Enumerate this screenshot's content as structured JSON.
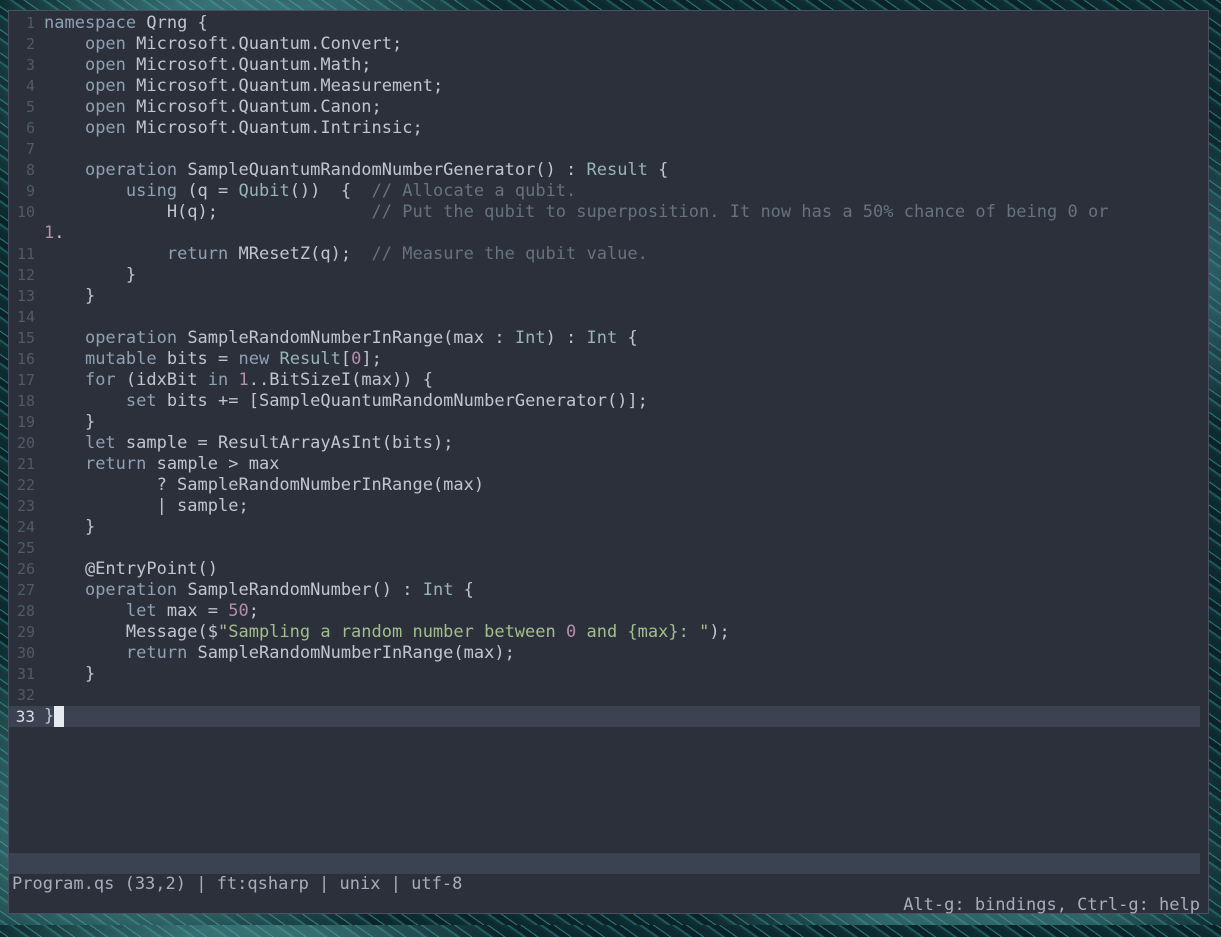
{
  "editor": {
    "lines": [
      {
        "n": "1",
        "text": "namespace Qrng {"
      },
      {
        "n": "2",
        "text": "    open Microsoft.Quantum.Convert;"
      },
      {
        "n": "3",
        "text": "    open Microsoft.Quantum.Math;"
      },
      {
        "n": "4",
        "text": "    open Microsoft.Quantum.Measurement;"
      },
      {
        "n": "5",
        "text": "    open Microsoft.Quantum.Canon;"
      },
      {
        "n": "6",
        "text": "    open Microsoft.Quantum.Intrinsic;"
      },
      {
        "n": "7",
        "text": ""
      },
      {
        "n": "8",
        "text": "    operation SampleQuantumRandomNumberGenerator() : Result {"
      },
      {
        "n": "9",
        "text": "        using (q = Qubit())  {  // Allocate a qubit."
      },
      {
        "n": "10",
        "text": "            H(q);               // Put the qubit to superposition. It now has a 50% chance of being 0 or"
      },
      {
        "n": "",
        "text": "1."
      },
      {
        "n": "11",
        "text": "            return MResetZ(q);  // Measure the qubit value."
      },
      {
        "n": "12",
        "text": "        }"
      },
      {
        "n": "13",
        "text": "    }"
      },
      {
        "n": "14",
        "text": ""
      },
      {
        "n": "15",
        "text": "    operation SampleRandomNumberInRange(max : Int) : Int {"
      },
      {
        "n": "16",
        "text": "    mutable bits = new Result[0];"
      },
      {
        "n": "17",
        "text": "    for (idxBit in 1..BitSizeI(max)) {"
      },
      {
        "n": "18",
        "text": "        set bits += [SampleQuantumRandomNumberGenerator()];"
      },
      {
        "n": "19",
        "text": "    }"
      },
      {
        "n": "20",
        "text": "    let sample = ResultArrayAsInt(bits);"
      },
      {
        "n": "21",
        "text": "    return sample > max"
      },
      {
        "n": "22",
        "text": "           ? SampleRandomNumberInRange(max)"
      },
      {
        "n": "23",
        "text": "           | sample;"
      },
      {
        "n": "24",
        "text": "    }"
      },
      {
        "n": "25",
        "text": ""
      },
      {
        "n": "26",
        "text": "    @EntryPoint()"
      },
      {
        "n": "27",
        "text": "    operation SampleRandomNumber() : Int {"
      },
      {
        "n": "28",
        "text": "        let max = 50;"
      },
      {
        "n": "29",
        "text": "        Message($\"Sampling a random number between 0 and {max}: \");"
      },
      {
        "n": "30",
        "text": "        return SampleRandomNumberInRange(max);"
      },
      {
        "n": "31",
        "text": "    }"
      },
      {
        "n": "32",
        "text": ""
      },
      {
        "n": "33",
        "text": "}"
      }
    ],
    "current_line": "33"
  },
  "status": {
    "left": "Program.qs (33,2) | ft:qsharp | unix | utf-8",
    "right": "Alt-g: bindings, Ctrl-g: help"
  }
}
